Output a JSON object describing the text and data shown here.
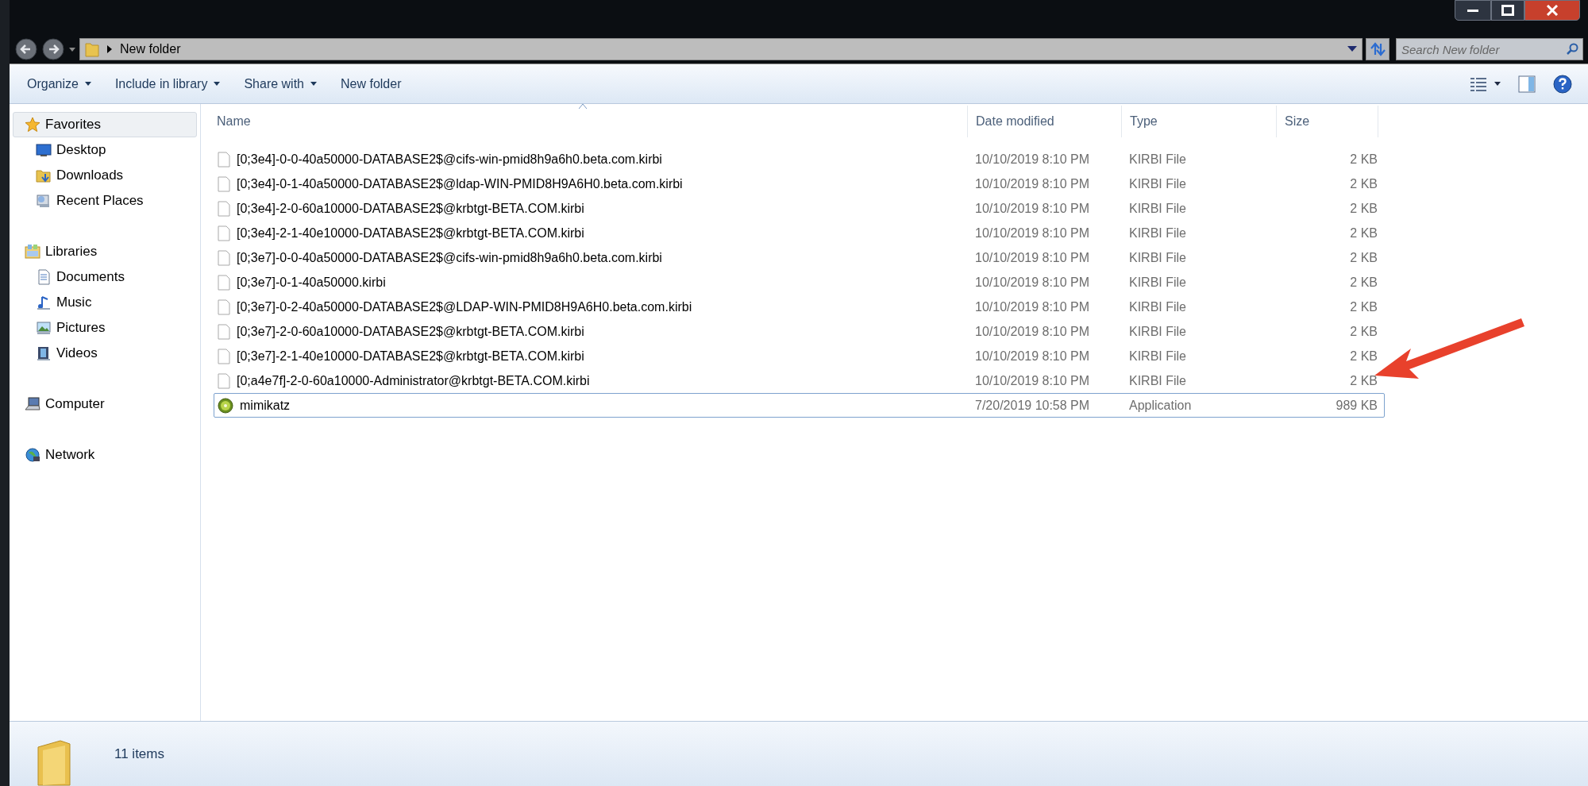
{
  "address_bar": {
    "path": "New folder"
  },
  "search": {
    "placeholder": "Search New folder"
  },
  "toolbar": [
    "Organize",
    "Include in library",
    "Share with",
    "New folder"
  ],
  "toolbar_dropdown": [
    true,
    true,
    true,
    false
  ],
  "sidebar": {
    "groups": [
      {
        "label": "Favorites",
        "kind": "favorites",
        "selected": true,
        "children": [
          {
            "label": "Desktop",
            "kind": "desktop",
            "selected": false
          },
          {
            "label": "Downloads",
            "kind": "downloads",
            "selected": false
          },
          {
            "label": "Recent Places",
            "kind": "recent",
            "selected": false
          }
        ]
      },
      {
        "label": "Libraries",
        "kind": "libraries",
        "selected": false,
        "children": [
          {
            "label": "Documents",
            "kind": "documents",
            "selected": false
          },
          {
            "label": "Music",
            "kind": "music",
            "selected": false
          },
          {
            "label": "Pictures",
            "kind": "pictures",
            "selected": false
          },
          {
            "label": "Videos",
            "kind": "videos",
            "selected": false
          }
        ]
      },
      {
        "label": "Computer",
        "kind": "computer",
        "selected": false
      },
      {
        "label": "Network",
        "kind": "network",
        "selected": false
      }
    ]
  },
  "table": {
    "columns": [
      "Name",
      "Date modified",
      "Type",
      "Size"
    ],
    "rows": [
      {
        "kind": "file",
        "focused": false,
        "cells": [
          "[0;3e4]-0-0-40a50000-DATABASE2$@cifs-win-pmid8h9a6h0.beta.com.kirbi",
          "10/10/2019 8:10 PM",
          "KIRBI File",
          "2 KB"
        ]
      },
      {
        "kind": "file",
        "focused": false,
        "cells": [
          "[0;3e4]-0-1-40a50000-DATABASE2$@ldap-WIN-PMID8H9A6H0.beta.com.kirbi",
          "10/10/2019 8:10 PM",
          "KIRBI File",
          "2 KB"
        ]
      },
      {
        "kind": "file",
        "focused": false,
        "cells": [
          "[0;3e4]-2-0-60a10000-DATABASE2$@krbtgt-BETA.COM.kirbi",
          "10/10/2019 8:10 PM",
          "KIRBI File",
          "2 KB"
        ]
      },
      {
        "kind": "file",
        "focused": false,
        "cells": [
          "[0;3e4]-2-1-40e10000-DATABASE2$@krbtgt-BETA.COM.kirbi",
          "10/10/2019 8:10 PM",
          "KIRBI File",
          "2 KB"
        ]
      },
      {
        "kind": "file",
        "focused": false,
        "cells": [
          "[0;3e7]-0-0-40a50000-DATABASE2$@cifs-win-pmid8h9a6h0.beta.com.kirbi",
          "10/10/2019 8:10 PM",
          "KIRBI File",
          "2 KB"
        ]
      },
      {
        "kind": "file",
        "focused": false,
        "cells": [
          "[0;3e7]-0-1-40a50000.kirbi",
          "10/10/2019 8:10 PM",
          "KIRBI File",
          "2 KB"
        ]
      },
      {
        "kind": "file",
        "focused": false,
        "cells": [
          "[0;3e7]-0-2-40a50000-DATABASE2$@LDAP-WIN-PMID8H9A6H0.beta.com.kirbi",
          "10/10/2019 8:10 PM",
          "KIRBI File",
          "2 KB"
        ]
      },
      {
        "kind": "file",
        "focused": false,
        "cells": [
          "[0;3e7]-2-0-60a10000-DATABASE2$@krbtgt-BETA.COM.kirbi",
          "10/10/2019 8:10 PM",
          "KIRBI File",
          "2 KB"
        ]
      },
      {
        "kind": "file",
        "focused": false,
        "cells": [
          "[0;3e7]-2-1-40e10000-DATABASE2$@krbtgt-BETA.COM.kirbi",
          "10/10/2019 8:10 PM",
          "KIRBI File",
          "2 KB"
        ]
      },
      {
        "kind": "file",
        "focused": false,
        "cells": [
          "[0;a4e7f]-2-0-60a10000-Administrator@krbtgt-BETA.COM.kirbi",
          "10/10/2019 8:10 PM",
          "KIRBI File",
          "2 KB"
        ]
      },
      {
        "kind": "application",
        "focused": true,
        "cells": [
          "mimikatz",
          "7/20/2019 10:58 PM",
          "Application",
          "989 KB"
        ]
      }
    ]
  },
  "status_bar": {
    "count": "11 items"
  }
}
